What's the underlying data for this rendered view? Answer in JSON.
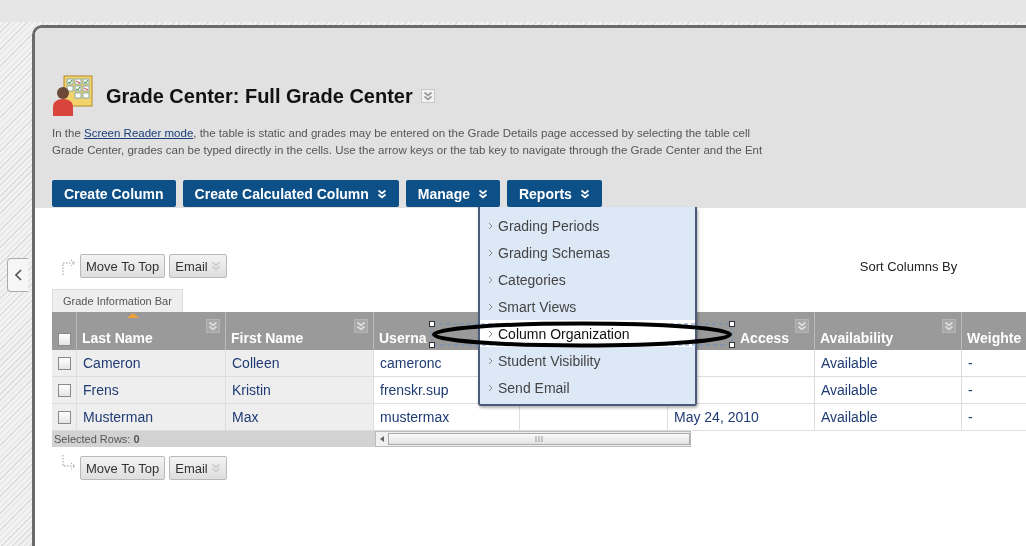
{
  "title": "Grade Center: Full Grade Center",
  "description": {
    "before": "In the ",
    "link": "Screen Reader mode",
    "after": ", the table is static and grades may be entered on the Grade Details page accessed by selecting the table cell",
    "line_2": "Grade Center, grades can be typed directly in the cells. Use the arrow keys or the tab key to navigate through the Grade Center and the Ent"
  },
  "action_buttons": [
    {
      "label": "Create Column",
      "dropdown": false
    },
    {
      "label": "Create Calculated Column",
      "dropdown": true
    },
    {
      "label": "Manage",
      "dropdown": true
    },
    {
      "label": "Reports",
      "dropdown": true
    }
  ],
  "manage_menu": [
    {
      "label": "Grading Periods",
      "selected": false
    },
    {
      "label": "Grading Schemas",
      "selected": false
    },
    {
      "label": "Categories",
      "selected": false
    },
    {
      "label": "Smart Views",
      "selected": false
    },
    {
      "label": "Column Organization",
      "selected": true
    },
    {
      "label": "Student Visibility",
      "selected": false
    },
    {
      "label": "Send Email",
      "selected": false
    }
  ],
  "top_toolbar": [
    {
      "label": "Move To Top",
      "dropdown": false
    },
    {
      "label": "Email",
      "dropdown": true
    }
  ],
  "sort_label": "Sort Columns By",
  "info_bar_tab": "Grade Information Bar",
  "table": {
    "select_all_checked": false,
    "columns": [
      {
        "label": "Last Name",
        "sorted": true,
        "menu": true
      },
      {
        "label": "First Name",
        "sorted": false,
        "menu": true
      },
      {
        "label": "Userna",
        "sorted": false,
        "menu": false
      },
      null,
      {
        "label": "Access",
        "sorted": false,
        "menu": true
      },
      {
        "label": "Availability",
        "sorted": false,
        "menu": true
      },
      {
        "label": "Weighte",
        "sorted": false,
        "menu": false
      }
    ],
    "rows": [
      {
        "checked": false,
        "cells": [
          "Cameron",
          "Colleen",
          "cameronc",
          null,
          null,
          "Available",
          "-"
        ]
      },
      {
        "checked": false,
        "cells": [
          "Frens",
          "Kristin",
          "frenskr.sup",
          null,
          null,
          "Available",
          "-"
        ]
      },
      {
        "checked": false,
        "cells": [
          "Musterman",
          "Max",
          "mustermax",
          null,
          "May 24, 2010",
          "Available",
          "-"
        ]
      }
    ],
    "selected_rows": "Selected Rows: **0**"
  },
  "bottom_toolbar": [
    {
      "label": "Move To Top",
      "dropdown": false
    },
    {
      "label": "Email",
      "dropdown": true
    }
  ]
}
